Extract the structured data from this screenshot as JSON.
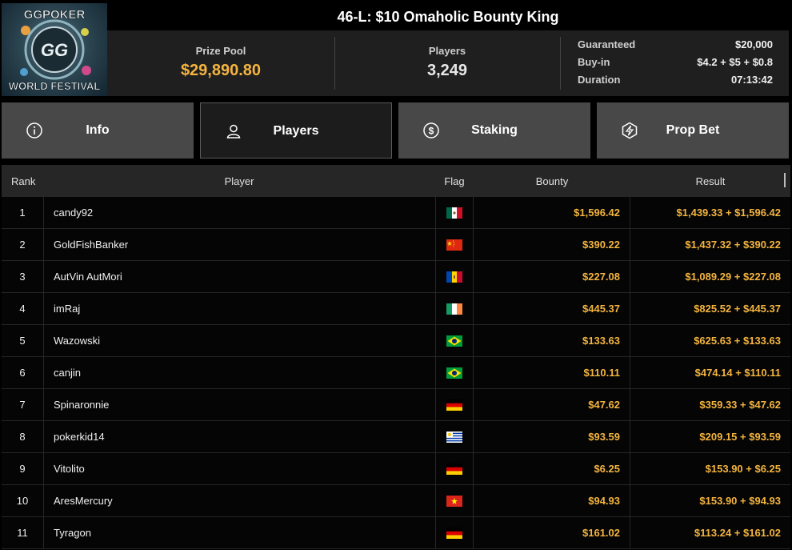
{
  "logo": {
    "line1": "GGPOKER",
    "line2": "WORLD FESTIVAL"
  },
  "title": "46-L: $10 Omaholic Bounty King",
  "stats": {
    "prize_pool_label": "Prize Pool",
    "prize_pool_value": "$29,890.80",
    "players_label": "Players",
    "players_value": "3,249"
  },
  "details": [
    {
      "key": "Guaranteed",
      "value": "$20,000"
    },
    {
      "key": "Buy-in",
      "value": "$4.2 + $5 + $0.8"
    },
    {
      "key": "Duration",
      "value": "07:13:42"
    }
  ],
  "tabs": [
    {
      "label": "Info",
      "icon": "info-icon",
      "active": false
    },
    {
      "label": "Players",
      "icon": "user-icon",
      "active": true
    },
    {
      "label": "Staking",
      "icon": "dollar-coin-icon",
      "active": false
    },
    {
      "label": "Prop Bet",
      "icon": "prop-bet-icon",
      "active": false
    }
  ],
  "table": {
    "headers": {
      "rank": "Rank",
      "player": "Player",
      "flag": "Flag",
      "bounty": "Bounty",
      "result": "Result"
    },
    "rows": [
      {
        "rank": "1",
        "player": "candy92",
        "flag": "mx",
        "bounty": "$1,596.42",
        "result": "$1,439.33 + $1,596.42"
      },
      {
        "rank": "2",
        "player": "GoldFishBanker",
        "flag": "cn",
        "bounty": "$390.22",
        "result": "$1,437.32 + $390.22"
      },
      {
        "rank": "3",
        "player": "AutVin AutMori",
        "flag": "md",
        "bounty": "$227.08",
        "result": "$1,089.29 + $227.08"
      },
      {
        "rank": "4",
        "player": "imRaj",
        "flag": "ie",
        "bounty": "$445.37",
        "result": "$825.52 + $445.37"
      },
      {
        "rank": "5",
        "player": "Wazowski",
        "flag": "br",
        "bounty": "$133.63",
        "result": "$625.63 + $133.63"
      },
      {
        "rank": "6",
        "player": "canjin",
        "flag": "br",
        "bounty": "$110.11",
        "result": "$474.14 + $110.11"
      },
      {
        "rank": "7",
        "player": "Spinaronnie",
        "flag": "de",
        "bounty": "$47.62",
        "result": "$359.33 + $47.62"
      },
      {
        "rank": "8",
        "player": "pokerkid14",
        "flag": "uy",
        "bounty": "$93.59",
        "result": "$209.15 + $93.59"
      },
      {
        "rank": "9",
        "player": "Vitolito",
        "flag": "de",
        "bounty": "$6.25",
        "result": "$153.90 + $6.25"
      },
      {
        "rank": "10",
        "player": "AresMercury",
        "flag": "vn",
        "bounty": "$94.93",
        "result": "$153.90 + $94.93"
      },
      {
        "rank": "11",
        "player": "Tyragon",
        "flag": "de",
        "bounty": "$161.02",
        "result": "$113.24 + $161.02"
      }
    ]
  },
  "colors": {
    "accent": "#f4b43e",
    "tab_bg": "#484848",
    "tab_active_bg": "#1c1c1c"
  }
}
